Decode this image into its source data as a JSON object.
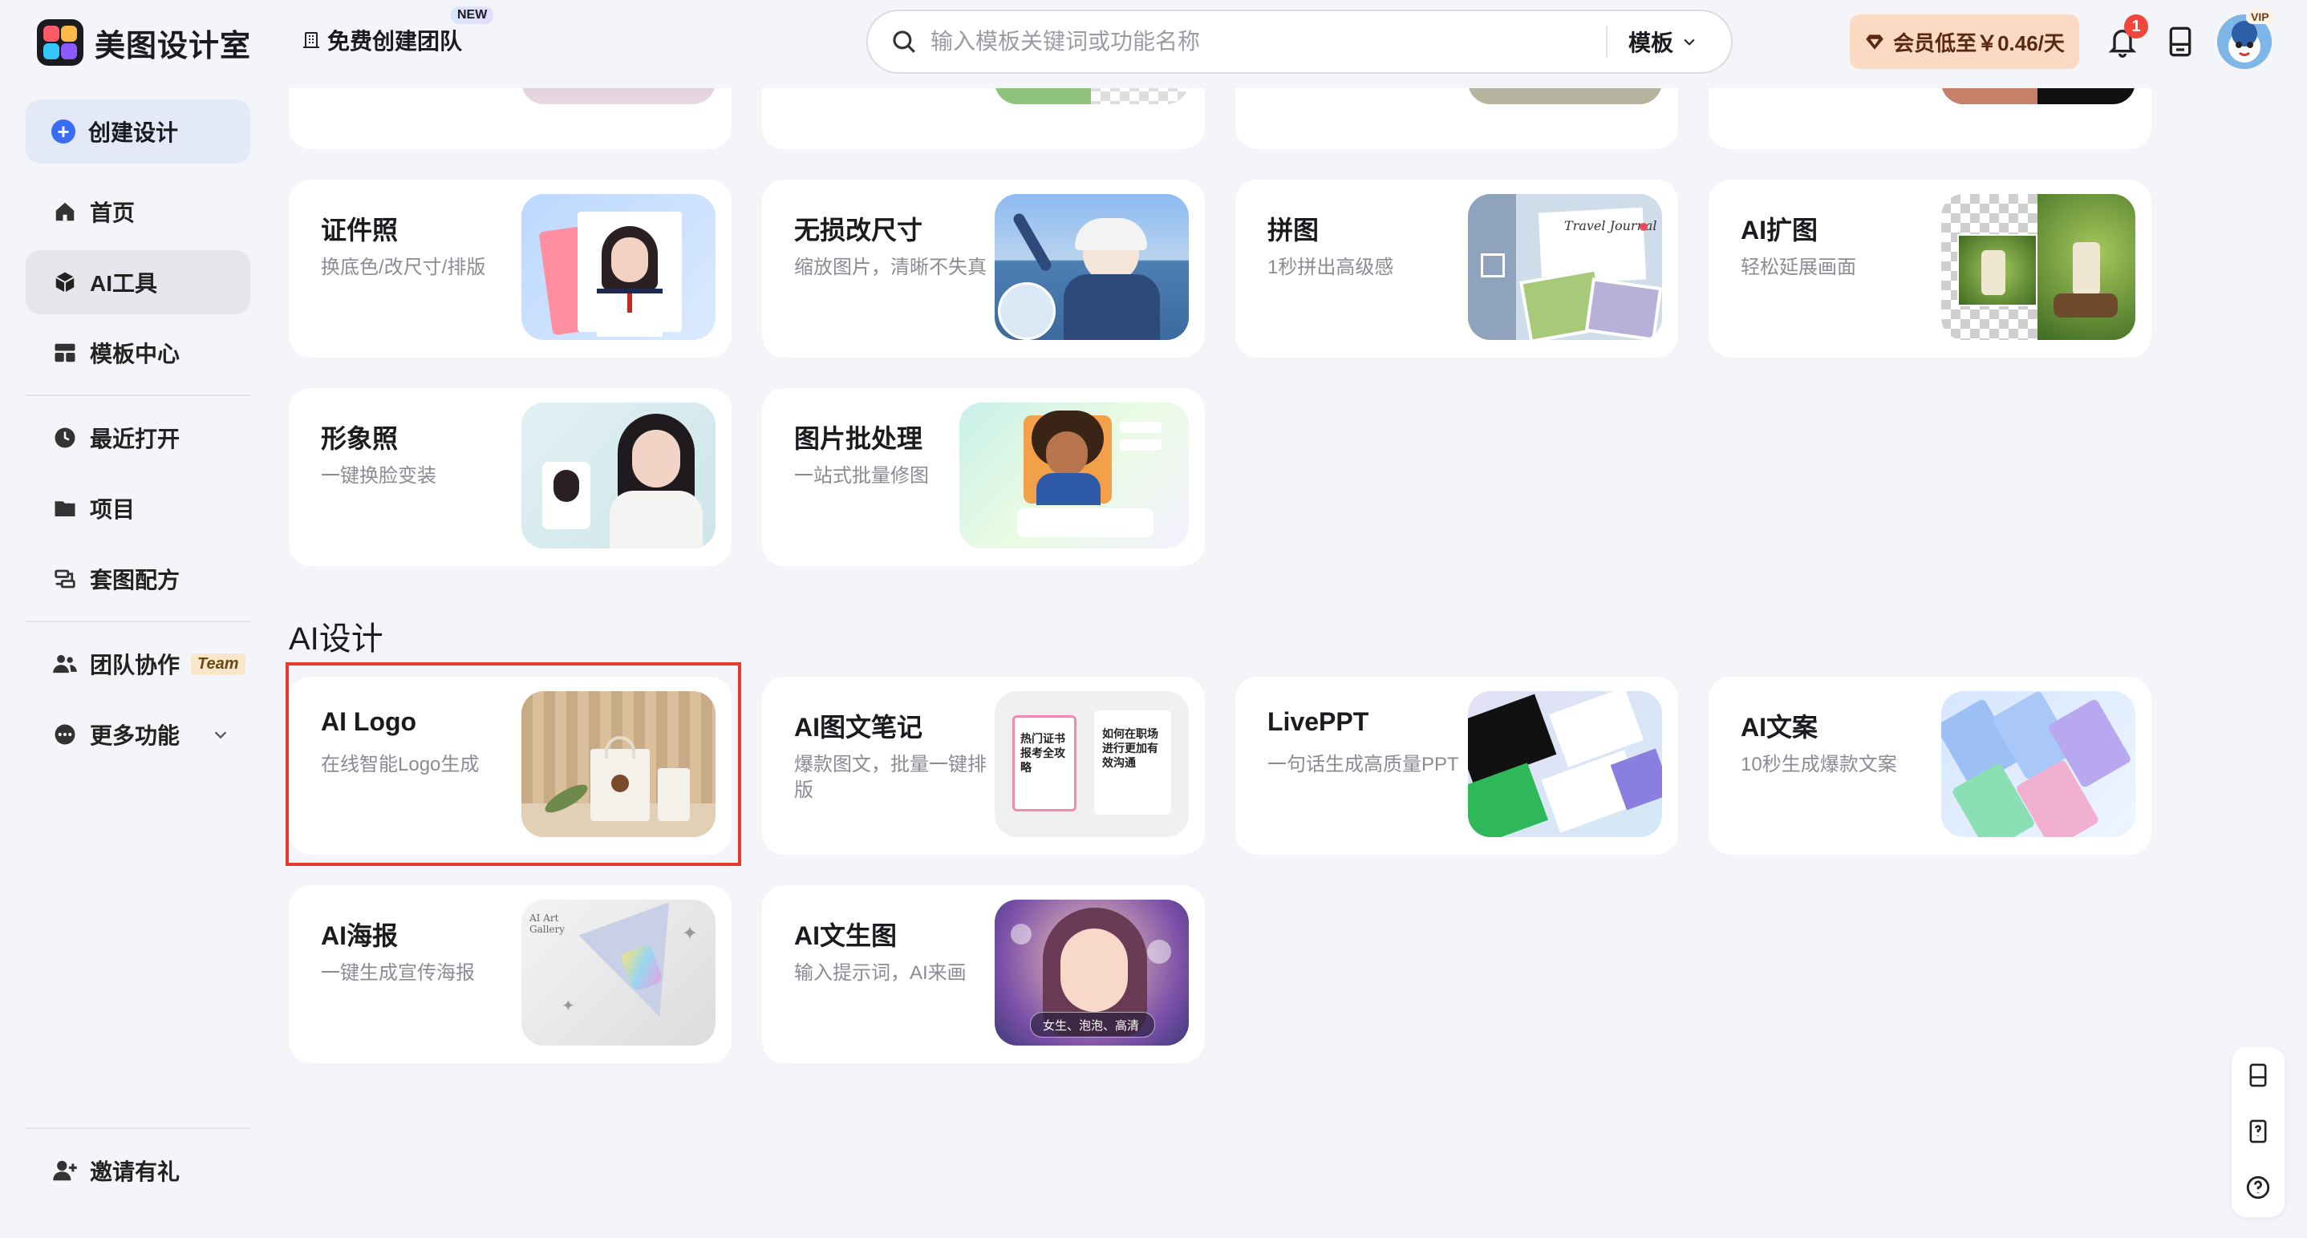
{
  "header": {
    "brand": "美图设计室",
    "team_link": "免费创建团队",
    "new_badge": "NEW",
    "search_placeholder": "输入模板关键词或功能名称",
    "search_scope": "模板",
    "vip_button": "会员低至￥0.46/天",
    "notification_count": "1",
    "avatar_tag": "VIP"
  },
  "sidebar": {
    "create": "创建设计",
    "items": [
      {
        "label": "首页",
        "icon": "home-icon"
      },
      {
        "label": "AI工具",
        "icon": "cube-icon",
        "active": true
      },
      {
        "label": "模板中心",
        "icon": "template-icon"
      },
      {
        "label": "最近打开",
        "icon": "clock-icon"
      },
      {
        "label": "项目",
        "icon": "folder-icon"
      },
      {
        "label": "套图配方",
        "icon": "recipe-icon"
      },
      {
        "label": "团队协作",
        "icon": "team-icon"
      },
      {
        "label": "更多功能",
        "icon": "more-icon"
      }
    ],
    "team_tag": "Team",
    "invite": "邀请有礼"
  },
  "tools_top_row_partial": [
    {
      "name": "partial-1"
    },
    {
      "name": "partial-2"
    },
    {
      "name": "partial-3"
    },
    {
      "name": "partial-4"
    }
  ],
  "tools": [
    {
      "title": "证件照",
      "desc": "换底色/改尺寸/排版"
    },
    {
      "title": "无损改尺寸",
      "desc": "缩放图片，清晰不失真"
    },
    {
      "title": "拼图",
      "desc": "1秒拼出高级感"
    },
    {
      "title": "AI扩图",
      "desc": "轻松延展画面"
    },
    {
      "title": "形象照",
      "desc": "一键换脸变装"
    },
    {
      "title": "图片批处理",
      "desc": "一站式批量修图"
    }
  ],
  "ai_section": {
    "title": "AI设计",
    "cards": [
      {
        "title": "AI Logo",
        "desc": "在线智能Logo生成"
      },
      {
        "title": "AI图文笔记",
        "desc": "爆款图文，批量一键排版"
      },
      {
        "title": "LivePPT",
        "desc": "一句话生成高质量PPT"
      },
      {
        "title": "AI文案",
        "desc": "10秒生成爆款文案"
      },
      {
        "title": "AI海报",
        "desc": "一键生成宣传海报"
      },
      {
        "title": "AI文生图",
        "desc": "输入提示词，AI来画"
      }
    ]
  },
  "thumbnail_text": {
    "note_left": "热门证书报考全攻略",
    "note_right": "如何在职场进行更加有效沟通",
    "txt2img_prompt": "女生、泡泡、高清",
    "poster_gallery": "AI Art Gallery",
    "collage_script": "Travel Journal"
  },
  "colors": {
    "accent": "#3b6cf6",
    "highlight": "#e43b2e",
    "vip_bg": "#fbd9c2"
  }
}
